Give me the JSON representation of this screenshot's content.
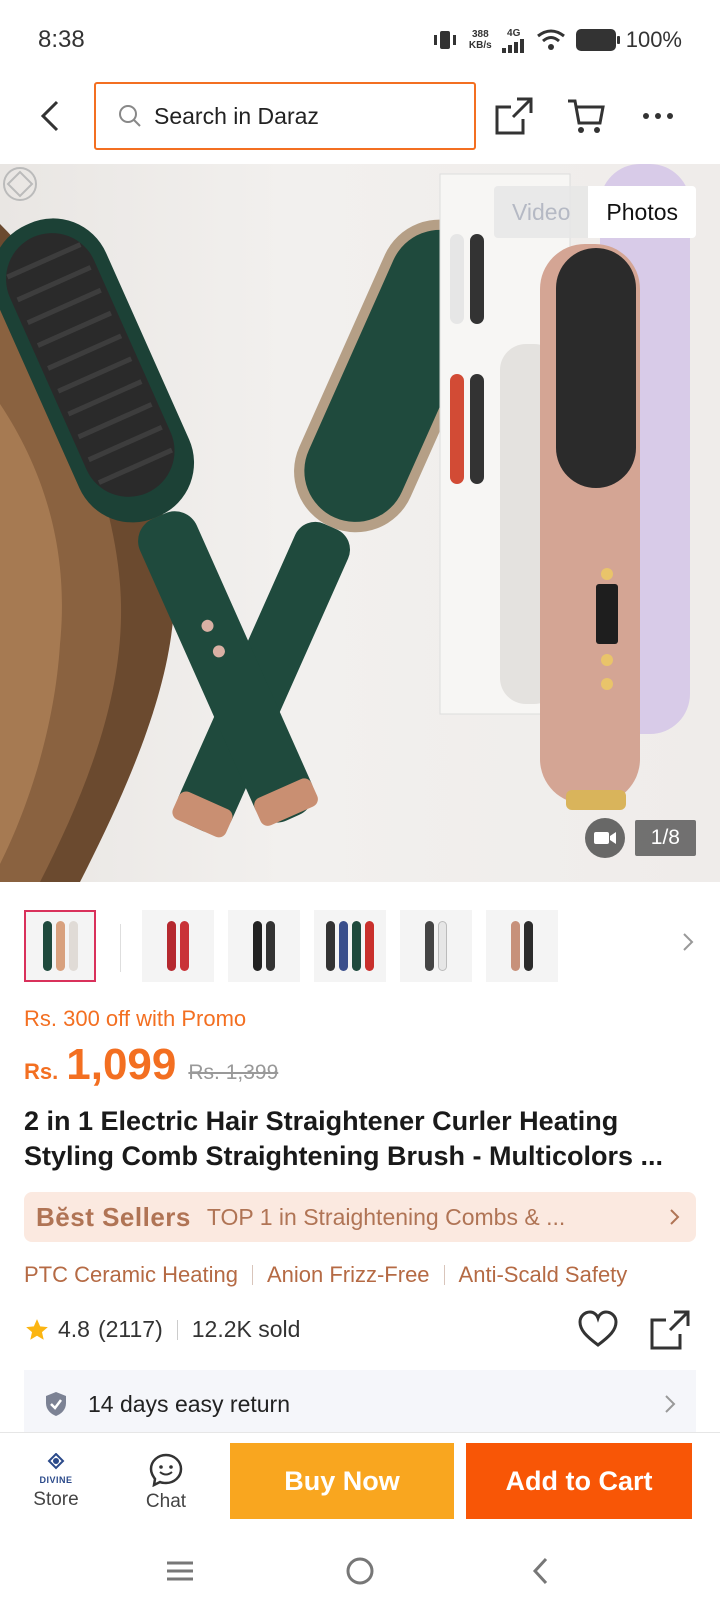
{
  "status_bar": {
    "time": "8:38",
    "speed_value": "388",
    "speed_unit": "KB/s",
    "network": "4G",
    "battery": "100%"
  },
  "header": {
    "search_placeholder": "Search in Daraz",
    "icons": [
      "back-arrow-icon",
      "share-icon",
      "cart-icon",
      "more-icon"
    ]
  },
  "gallery": {
    "video_tab": "Video",
    "photos_tab": "Photos",
    "counter": "1/8",
    "selected_tab": "Photos"
  },
  "thumbnails": [
    {
      "colors": [
        "#1f4a3d",
        "#d8a17e",
        "#e8e2dc"
      ]
    },
    {
      "colors": [
        "#b5292f",
        "#c93338",
        "#9b1f25"
      ]
    },
    {
      "colors": [
        "#222222",
        "#333333",
        "#1a1a1a"
      ]
    },
    {
      "colors": [
        "#333333",
        "#3a4f8c",
        "#1f4a3d",
        "#c9302c"
      ]
    },
    {
      "colors": [
        "#444444",
        "#e6e6e6",
        "#555555"
      ]
    },
    {
      "colors": [
        "#c7917a",
        "#d6a28a",
        "#2b2b2b"
      ]
    }
  ],
  "price": {
    "promo_text": "Rs. 300 off with Promo",
    "currency": "Rs.",
    "current": "1,099",
    "original": "Rs. 1,399"
  },
  "product": {
    "title": "2 in 1 Electric Hair Straightener Curler Heating Styling Comb Straightening Brush - Multicolors ..."
  },
  "best_sellers": {
    "logo": "Bĕst Sellers",
    "text": "TOP 1 in Straightening Combs & ..."
  },
  "features": [
    "PTC Ceramic Heating",
    "Anion Frizz-Free",
    "Anti-Scald Safety"
  ],
  "rating": {
    "score": "4.8",
    "count": "(2117)",
    "sold": "12.2K sold"
  },
  "returns": {
    "text": "14 days easy return"
  },
  "actions": {
    "store_label": "Store",
    "store_brand": "DIVINE",
    "chat_label": "Chat",
    "buy_now": "Buy Now",
    "add_to_cart": "Add to Cart"
  },
  "colors": {
    "accent": "#f36f21",
    "buy_now": "#f9a61f",
    "add_to_cart": "#f85606",
    "best_seller_bg": "#fbe9e0",
    "best_seller_text": "#b07455"
  }
}
